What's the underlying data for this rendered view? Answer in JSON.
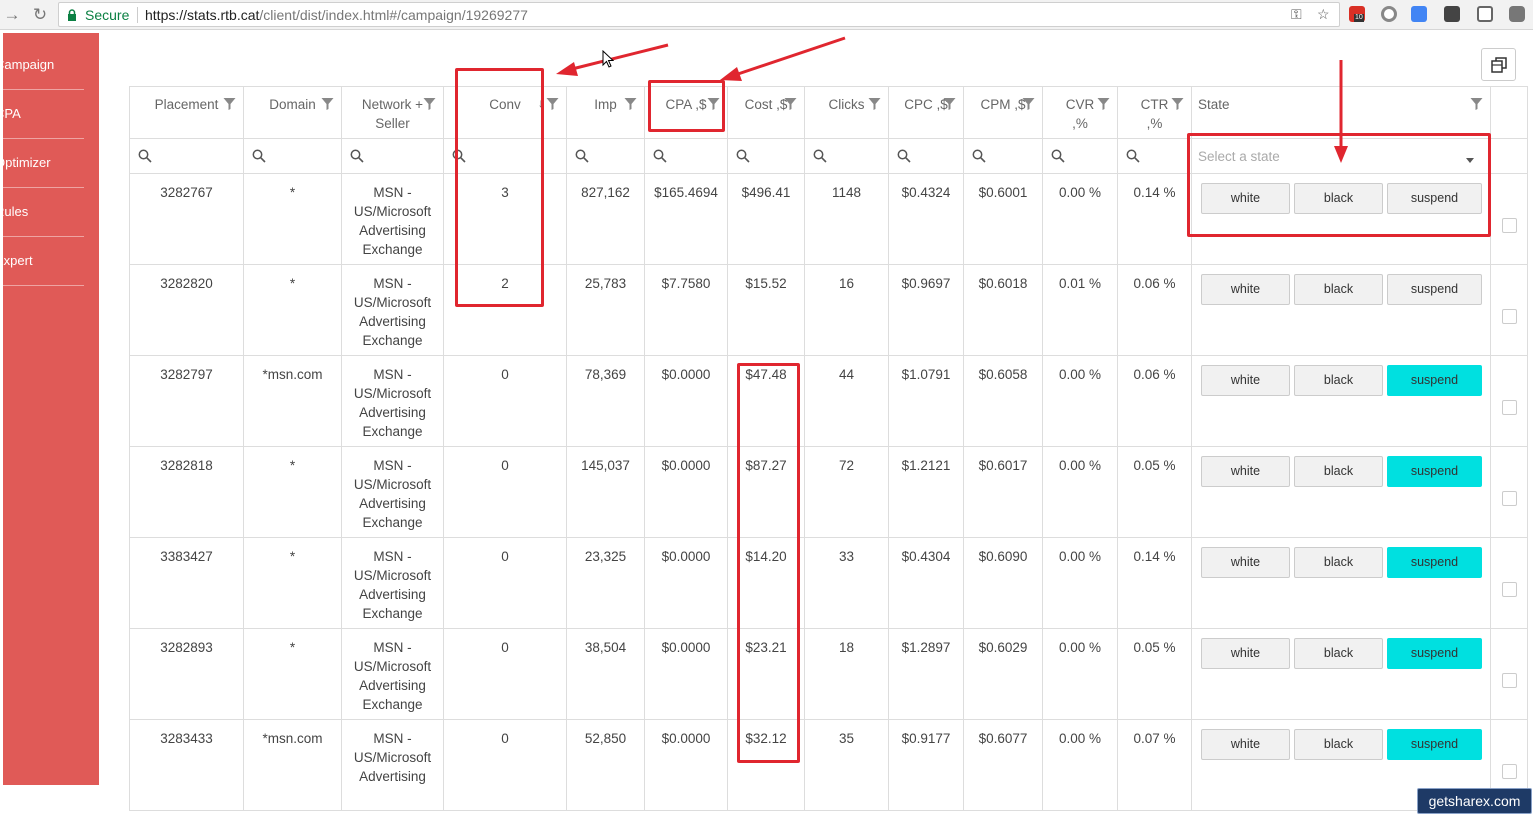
{
  "browser": {
    "secure_label": "Secure",
    "url_host": "https://stats.rtb.cat",
    "url_path": "/client/dist/index.html#/campaign/19269277",
    "ext_badge": "10"
  },
  "sidebar": {
    "items": [
      {
        "label": "Campaign"
      },
      {
        "label": "CPA"
      },
      {
        "label": "Optimizer"
      },
      {
        "label": "Rules"
      },
      {
        "label": "Expert"
      }
    ]
  },
  "table": {
    "headers": [
      "Placement",
      "Domain",
      "Network + Seller",
      "Conv",
      "Imp",
      "CPA ,$",
      "Cost ,$",
      "Clicks",
      "CPC ,$",
      "CPM ,$",
      "CVR ,%",
      "CTR ,%",
      "State"
    ],
    "state_placeholder": "Select a state",
    "state_buttons": {
      "white": "white",
      "black": "black",
      "suspend": "suspend"
    },
    "rows": [
      {
        "placement": "3282767",
        "domain": "*",
        "network": "MSN - US/Microsoft Advertising Exchange",
        "conv": "3",
        "imp": "827,162",
        "cpa": "$165.4694",
        "cost": "$496.41",
        "clicks": "1148",
        "cpc": "$0.4324",
        "cpm": "$0.6001",
        "cvr": "0.00 %",
        "ctr": "0.14 %",
        "suspended": false
      },
      {
        "placement": "3282820",
        "domain": "*",
        "network": "MSN - US/Microsoft Advertising Exchange",
        "conv": "2",
        "imp": "25,783",
        "cpa": "$7.7580",
        "cost": "$15.52",
        "clicks": "16",
        "cpc": "$0.9697",
        "cpm": "$0.6018",
        "cvr": "0.01 %",
        "ctr": "0.06 %",
        "suspended": false
      },
      {
        "placement": "3282797",
        "domain": "*msn.com",
        "network": "MSN - US/Microsoft Advertising Exchange",
        "conv": "0",
        "imp": "78,369",
        "cpa": "$0.0000",
        "cost": "$47.48",
        "clicks": "44",
        "cpc": "$1.0791",
        "cpm": "$0.6058",
        "cvr": "0.00 %",
        "ctr": "0.06 %",
        "suspended": true
      },
      {
        "placement": "3282818",
        "domain": "*",
        "network": "MSN - US/Microsoft Advertising Exchange",
        "conv": "0",
        "imp": "145,037",
        "cpa": "$0.0000",
        "cost": "$87.27",
        "clicks": "72",
        "cpc": "$1.2121",
        "cpm": "$0.6017",
        "cvr": "0.00 %",
        "ctr": "0.05 %",
        "suspended": true
      },
      {
        "placement": "3383427",
        "domain": "*",
        "network": "MSN - US/Microsoft Advertising Exchange",
        "conv": "0",
        "imp": "23,325",
        "cpa": "$0.0000",
        "cost": "$14.20",
        "clicks": "33",
        "cpc": "$0.4304",
        "cpm": "$0.6090",
        "cvr": "0.00 %",
        "ctr": "0.14 %",
        "suspended": true
      },
      {
        "placement": "3282893",
        "domain": "*",
        "network": "MSN - US/Microsoft Advertising Exchange",
        "conv": "0",
        "imp": "38,504",
        "cpa": "$0.0000",
        "cost": "$23.21",
        "clicks": "18",
        "cpc": "$1.2897",
        "cpm": "$0.6029",
        "cvr": "0.00 %",
        "ctr": "0.05 %",
        "suspended": true
      },
      {
        "placement": "3283433",
        "domain": "*msn.com",
        "network": "MSN - US/Microsoft Advertising",
        "conv": "0",
        "imp": "52,850",
        "cpa": "$0.0000",
        "cost": "$32.12",
        "clicks": "35",
        "cpc": "$0.9177",
        "cpm": "$0.6077",
        "cvr": "0.00 %",
        "ctr": "0.07 %",
        "suspended": true
      }
    ]
  },
  "colors": {
    "sidebar": "#e05a57",
    "suspend_active": "#00e0e0",
    "annotation": "#e0262f"
  },
  "watermark": "getsharex.com"
}
